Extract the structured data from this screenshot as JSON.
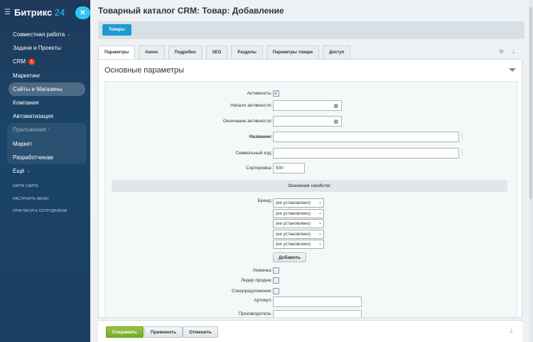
{
  "sidebar": {
    "logo_main": "Битрикс",
    "logo_num": "24",
    "items": [
      {
        "label": "Совместная работа",
        "chev": "⌄"
      },
      {
        "label": "Задачи и Проекты"
      },
      {
        "label": "CRM",
        "badge": "1"
      },
      {
        "label": "Маркетинг"
      },
      {
        "label": "Сайты и Магазины"
      },
      {
        "label": "Компания"
      },
      {
        "label": "Автоматизация"
      },
      {
        "label": "Приложения",
        "chev": "^"
      },
      {
        "label": "Маркет"
      },
      {
        "label": "Разработчикам"
      },
      {
        "label": "Ещё",
        "chev": "⌄"
      }
    ],
    "links": [
      "КАРТА САЙТА",
      "НАСТРОИТЬ МЕНЮ",
      "ПРИГЛАСИТЬ СОТРУДНИКОВ"
    ]
  },
  "page": {
    "title": "Товарный каталог CRM: Товар: Добавление",
    "breadcrumb": "Товары"
  },
  "tabs": [
    "Параметры",
    "Анонс",
    "Подробно",
    "SEO",
    "Разделы",
    "Параметры товара",
    "Доступ"
  ],
  "section": {
    "title": "Основные параметры",
    "fields": {
      "active": "Активность:",
      "active_from": "Начало активности:",
      "active_to": "Окончание активности:",
      "name": "Название:",
      "code": "Символьный код:",
      "sort": "Сортировка:",
      "sort_value": "500"
    },
    "props_header": "Значения свойств:",
    "brand_label": "Бренд:",
    "brand_options": [
      "(не установлено)",
      "(не установлено)",
      "(не установлено)",
      "(не установлено)",
      "(не установлено)"
    ],
    "add_button": "Добавить",
    "new_label": "Новинка:",
    "leader_label": "Лидер продаж:",
    "special_label": "Спецпредложение:",
    "article_label": "Артикул:",
    "maker_label": "Производитель:"
  },
  "footer": {
    "save": "Сохранить",
    "apply": "Применить",
    "cancel": "Отменить"
  }
}
